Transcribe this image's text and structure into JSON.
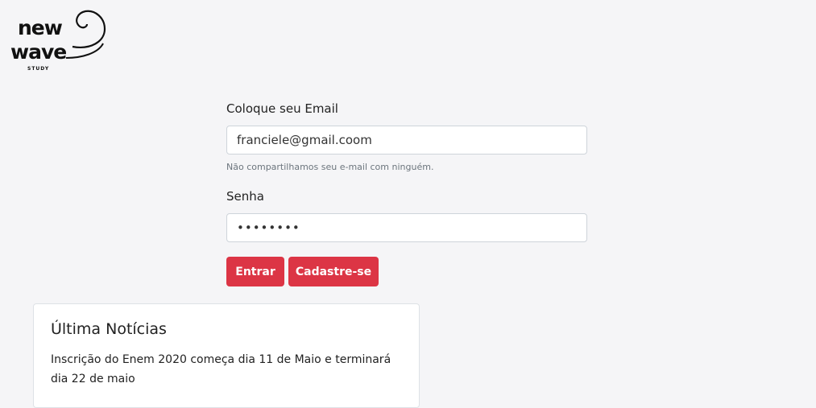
{
  "logo": {
    "line1": "new",
    "line2": "wave",
    "line3": "STUDY"
  },
  "form": {
    "email_label": "Coloque seu Email",
    "email_value": "franciele@gmail.coom",
    "email_help": "Não compartilhamos seu e-mail com ninguém.",
    "password_label": "Senha",
    "password_value": "••••••••",
    "login_button": "Entrar",
    "signup_button": "Cadastre-se"
  },
  "news": {
    "title": "Última Notícias",
    "text": "Inscrição do Enem 2020 começa dia 11 de Maio e terminará dia 22 de maio"
  },
  "colors": {
    "primary_button": "#dc3545",
    "background": "#f5f5f7"
  }
}
